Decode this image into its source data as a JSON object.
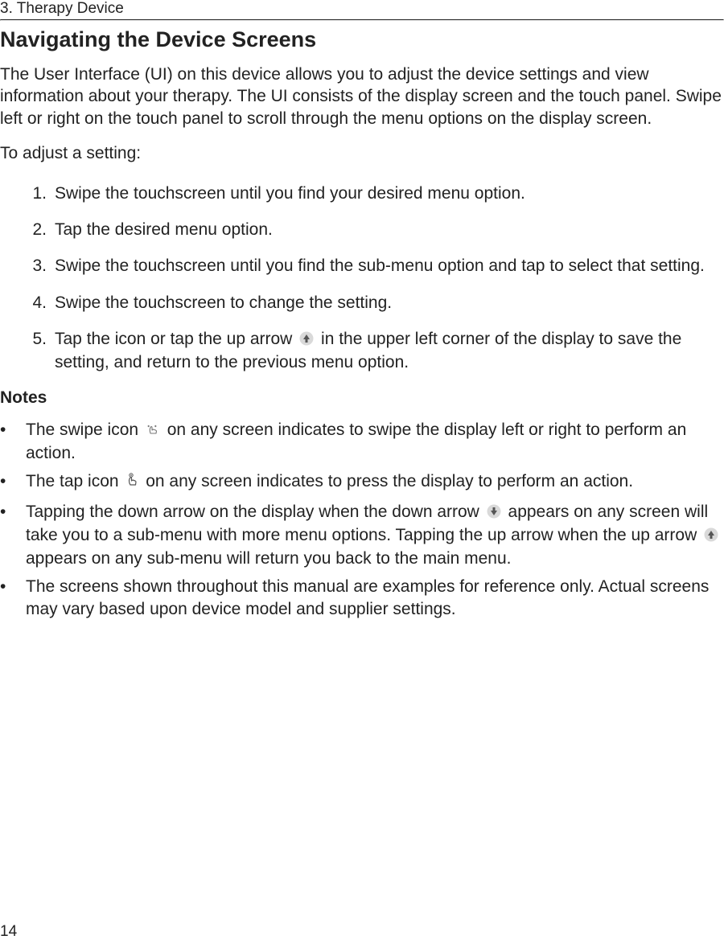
{
  "header": {
    "chapter": "3. Therapy Device"
  },
  "title": "Navigating the Device Screens",
  "intro": "The User Interface (UI) on this device allows you to adjust the device settings and view information about your therapy. The UI consists of the display screen and the touch panel. Swipe left or right on the touch panel to scroll through the menu options on the display screen.",
  "adjust_lead": "To adjust a setting:",
  "steps": [
    "Swipe the touchscreen until you find your desired menu option.",
    "Tap the desired menu option.",
    "Swipe the touchscreen until you find the sub-menu option and tap to select that setting.",
    "Swipe the touchscreen to change the setting."
  ],
  "step5": {
    "pre": "Tap the icon or tap the up arrow ",
    "post": " in the upper left corner of the display to save the setting, and return to the previous menu option."
  },
  "notes_title": "Notes",
  "notes": {
    "n1": {
      "pre": "The swipe icon ",
      "post": " on any screen indicates to swipe the display left or right to perform an action."
    },
    "n2": {
      "pre": "The tap icon ",
      "post": " on any screen indicates to press the display to perform an action."
    },
    "n3": {
      "pre": "Tapping the down arrow on the display when the down arrow ",
      "mid": " appears on any screen will take you to a sub-menu with more menu options. Tapping the up arrow when the up arrow ",
      "post": " appears on any sub-menu will return you back to the main menu."
    },
    "n4": "The screens shown throughout this manual are examples for reference only.  Actual screens may vary based upon device model and supplier settings."
  },
  "page_number": "14",
  "icons": {
    "up_arrow": "up-arrow-icon",
    "down_arrow": "down-arrow-icon",
    "swipe": "swipe-icon",
    "tap": "tap-icon"
  }
}
